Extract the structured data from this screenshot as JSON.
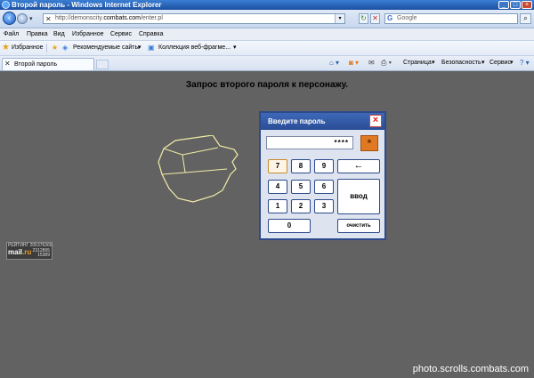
{
  "window": {
    "title": "Второй пароль - Windows Internet Explorer"
  },
  "address_bar": {
    "url_prefix": "http://demonscity.",
    "url_domain": "combats.com",
    "url_suffix": "/enter.pl"
  },
  "search": {
    "placeholder": "Google"
  },
  "menu": [
    "Файл",
    "Правка",
    "Вид",
    "Избранное",
    "Сервис",
    "Справка"
  ],
  "favorites_bar": {
    "favorites_label": "Избранное",
    "suggested_sites": "Рекомендуемые сайты",
    "web_slices": "Коллекция веб-фрагме..."
  },
  "tab": {
    "title": "Второй пароль"
  },
  "command_bar": {
    "page": "Страница",
    "security": "Безопасность",
    "tools": "Сервис"
  },
  "content": {
    "heading": "Запрос второго пароля к персонажу."
  },
  "rating_badge": {
    "line1": "РЕЙТИНГ 205376366",
    "brand": "mail",
    "brand_tld": ".ru",
    "stats": "2312895\n15389"
  },
  "dialog": {
    "title": "Введите пароль",
    "password_mask": "****",
    "keys": {
      "k7": "7",
      "k8": "8",
      "k9": "9",
      "k4": "4",
      "k5": "5",
      "k6": "6",
      "k1": "1",
      "k2": "2",
      "k3": "3",
      "k0": "0",
      "backspace": "←",
      "enter": "ввод",
      "clear": "очистить",
      "toggle": "*"
    }
  },
  "watermark": "photo.scrolls.combats.com",
  "colors": {
    "page_bg": "#626262",
    "dialog_header": "#2a4d96",
    "accent_orange": "#e07a22"
  }
}
